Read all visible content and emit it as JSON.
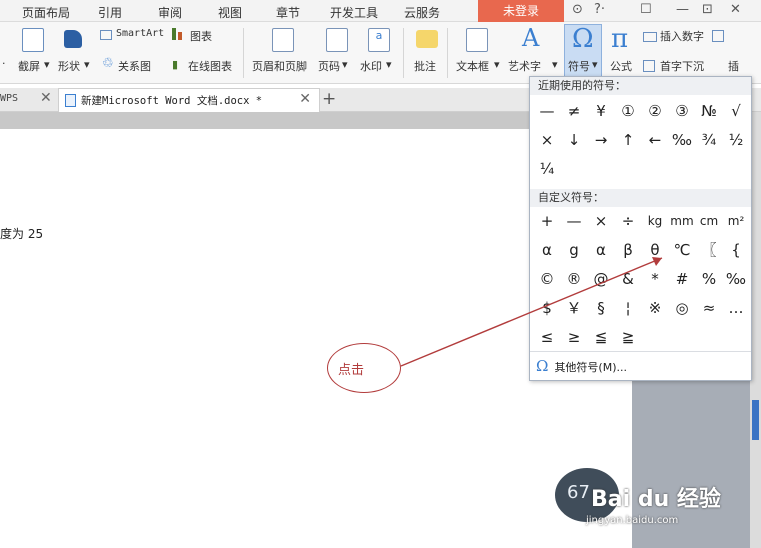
{
  "menubar": {
    "items": [
      "页面布局",
      "引用",
      "审阅",
      "视图",
      "章节",
      "开发工具",
      "云服务"
    ],
    "login_label": "未登录",
    "right_icons": [
      "⊙",
      "☐",
      "—",
      "⊡",
      "✕"
    ]
  },
  "ribbon": {
    "left_partial": "·",
    "jieping": "截屏",
    "xingzhuang": "形状",
    "smartart": "SmartArt",
    "tubiao": "图表",
    "guanxitu": "关系图",
    "zaixian": "在线图表",
    "yemei": "页眉和页脚",
    "yema": "页码",
    "shuiyin": "水印",
    "pizhu": "批注",
    "wenbenkuang": "文本框",
    "yishuzi": "艺术字",
    "fuhao": "符号",
    "gongshi": "公式",
    "charu_shuzi": "插入数字",
    "shouzi": "首字下沉",
    "right_partial": "插"
  },
  "tabs": {
    "wps_label": "WPS",
    "doc_label": "新建Microsoft Word 文档.docx *"
  },
  "document": {
    "text": "度为 25"
  },
  "symbol_panel": {
    "recent_title": "近期使用的符号：",
    "recent": [
      "—",
      "≠",
      "¥",
      "①",
      "②",
      "③",
      "№",
      "√",
      "×",
      "↓",
      "→",
      "↑",
      "←",
      "‰",
      "¾",
      "½",
      "¼"
    ],
    "custom_title": "自定义符号：",
    "custom": [
      "+",
      "—",
      "×",
      "÷",
      "kg",
      "mm",
      "cm",
      "m²",
      "α",
      "g",
      "α",
      "β",
      "θ",
      "℃",
      "〖",
      "{",
      "©",
      "®",
      "@",
      "&",
      "*",
      "#",
      "%",
      "‰",
      "$",
      "￥",
      "§",
      "¦",
      "※",
      "◎",
      "≈",
      "…",
      "≤",
      "≥",
      "≦",
      "≧"
    ],
    "more_label": "其他符号(M)..."
  },
  "annotation": {
    "label": "点击",
    "color": "#b23c3c"
  },
  "watermark": {
    "number": "67",
    "brand": "Bai du 经验",
    "url": "jingyan.baidu.com"
  }
}
